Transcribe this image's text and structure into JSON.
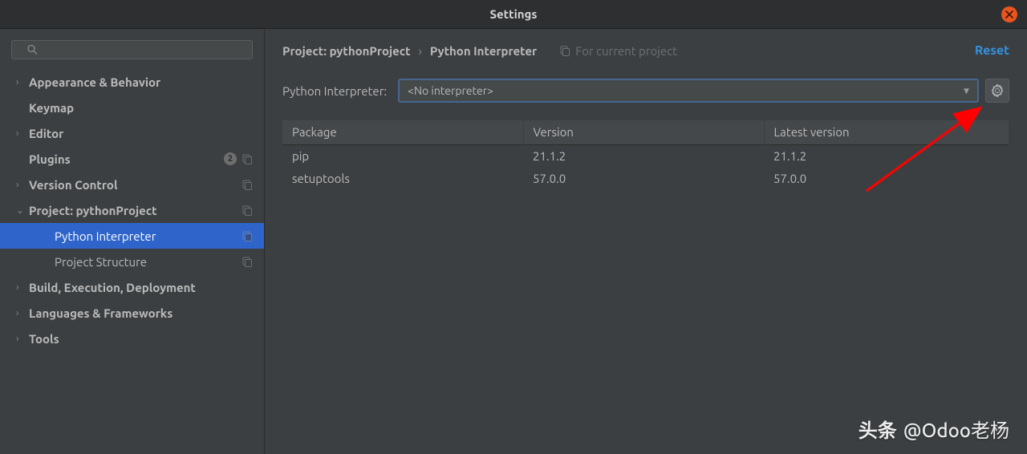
{
  "title": "Settings",
  "search": {
    "placeholder": ""
  },
  "sidebar": [
    {
      "label": "Appearance & Behavior",
      "caret": "right",
      "child": false,
      "badge": null,
      "copy": false,
      "selected": false
    },
    {
      "label": "Keymap",
      "caret": "none",
      "child": false,
      "badge": null,
      "copy": false,
      "selected": false
    },
    {
      "label": "Editor",
      "caret": "right",
      "child": false,
      "badge": null,
      "copy": false,
      "selected": false
    },
    {
      "label": "Plugins",
      "caret": "none",
      "child": false,
      "badge": "2",
      "copy": true,
      "selected": false
    },
    {
      "label": "Version Control",
      "caret": "right",
      "child": false,
      "badge": null,
      "copy": true,
      "selected": false
    },
    {
      "label": "Project: pythonProject",
      "caret": "down",
      "child": false,
      "badge": null,
      "copy": true,
      "selected": false
    },
    {
      "label": "Python Interpreter",
      "caret": "none",
      "child": true,
      "badge": null,
      "copy": true,
      "selected": true
    },
    {
      "label": "Project Structure",
      "caret": "none",
      "child": true,
      "badge": null,
      "copy": true,
      "selected": false
    },
    {
      "label": "Build, Execution, Deployment",
      "caret": "right",
      "child": false,
      "badge": null,
      "copy": false,
      "selected": false
    },
    {
      "label": "Languages & Frameworks",
      "caret": "right",
      "child": false,
      "badge": null,
      "copy": false,
      "selected": false
    },
    {
      "label": "Tools",
      "caret": "right",
      "child": false,
      "badge": null,
      "copy": false,
      "selected": false
    }
  ],
  "breadcrumb": {
    "root": "Project: pythonProject",
    "leaf": "Python Interpreter",
    "scope_label": "For current project",
    "reset": "Reset"
  },
  "interpreter": {
    "label": "Python Interpreter:",
    "value": "<No interpreter>"
  },
  "table": {
    "cols": [
      "Package",
      "Version",
      "Latest version"
    ],
    "rows": [
      {
        "pkg": "pip",
        "ver": "21.1.2",
        "latest": "21.1.2"
      },
      {
        "pkg": "setuptools",
        "ver": "57.0.0",
        "latest": "57.0.0"
      }
    ]
  },
  "watermark": {
    "prefix": "头条",
    "handle": "@Odoo老杨"
  }
}
